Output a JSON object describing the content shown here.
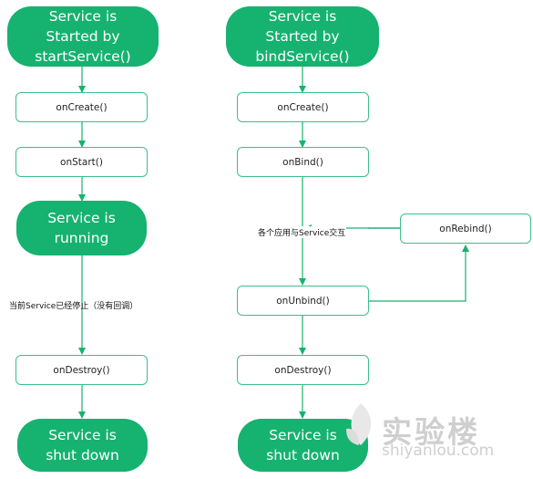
{
  "left_flow": {
    "start": "Service is\nStarted by\nstartService()",
    "on_create": "onCreate()",
    "on_start": "onStart()",
    "running": "Service is\nrunning",
    "stop_label": "当前Service已经停止（没有回调）",
    "on_destroy": "onDestroy()",
    "end": "Service is\nshut down"
  },
  "right_flow": {
    "start": "Service is\nStarted by\nbindService()",
    "on_create": "onCreate()",
    "on_bind": "onBind()",
    "interact_label": "各个应用与Service交互",
    "on_rebind": "onRebind()",
    "on_unbind": "onUnbind()",
    "on_destroy": "onDestroy()",
    "end": "Service is\nshut down"
  },
  "watermark": {
    "cn": "实验楼",
    "url": "shiyanlou.com"
  },
  "colors": {
    "pill_fill": "#16b270",
    "box_border": "#3cbf8a",
    "arrow": "#16b270"
  }
}
